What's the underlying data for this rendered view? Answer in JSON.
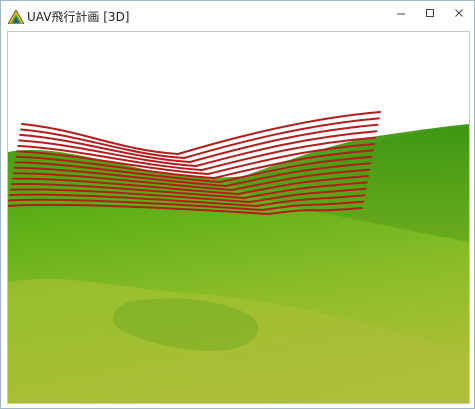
{
  "window": {
    "title": "UAV飛行計画 [3D]",
    "app_icon": "terrain-triangle-icon",
    "controls": {
      "minimize_icon": "minimize-icon",
      "maximize_icon": "maximize-icon",
      "close_icon": "close-icon"
    }
  },
  "scene": {
    "type": "3d-terrain-view",
    "sky_color": "#ffffff",
    "terrain_colors": [
      "#3f9b12",
      "#5fb018",
      "#8cbd28",
      "#aabf34"
    ],
    "flight_path_color": "#b51c1c",
    "flight_line_count": 16
  }
}
